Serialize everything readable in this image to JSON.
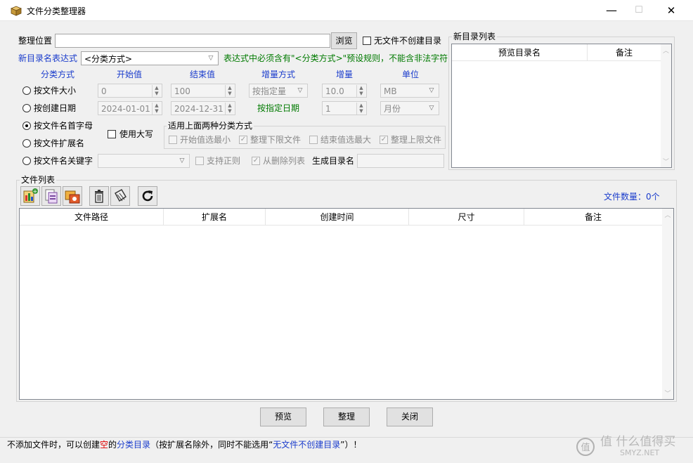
{
  "window": {
    "title": "文件分类整理器",
    "min": "—",
    "max": "☐",
    "close": "✕"
  },
  "location": {
    "label": "整理位置",
    "value": "",
    "browse": "浏览",
    "no_create_label": "无文件不创建目录"
  },
  "expr": {
    "label": "新目录名表达式",
    "value": "<分类方式>",
    "hint": "表达式中必须含有\"<分类方式>\"预设规则，不能含非法字符"
  },
  "headers": {
    "mode": "分类方式",
    "start": "开始值",
    "end": "结束值",
    "inc_mode": "增量方式",
    "inc": "增量",
    "unit": "单位"
  },
  "rows": {
    "size": {
      "label": "按文件大小",
      "start": "0",
      "end": "100",
      "inc_mode": "按指定量",
      "inc": "10.0",
      "unit": "MB"
    },
    "date": {
      "label": "按创建日期",
      "start": "2024-01-01",
      "end": "2024-12-31",
      "inc_mode": "按指定日期",
      "inc": "1",
      "unit": "月份"
    },
    "initial": {
      "label": "按文件名首字母",
      "uppercase": "使用大写"
    },
    "ext": {
      "label": "按文件扩展名"
    },
    "keyword": {
      "label": "按文件名关键字",
      "value": "",
      "regex": "支持正则",
      "remove_from_list": "从删除列表",
      "gen_dir_label": "生成目录名",
      "gen_dir_value": ""
    }
  },
  "applies": {
    "title": "适用上面两种分类方式",
    "start_min": "开始值选最小",
    "lower_file": "整理下限文件",
    "end_max": "结束值选最大",
    "upper_file": "整理上限文件"
  },
  "new_dirs": {
    "title": "新目录列表",
    "col_preview": "预览目录名",
    "col_note": "备注"
  },
  "files": {
    "title": "文件列表",
    "count_label": "文件数量：0个",
    "cols": [
      "文件路径",
      "扩展名",
      "创建时间",
      "尺寸",
      "备注"
    ]
  },
  "toolbar": {
    "icons": [
      "add-files-icon",
      "add-folder-icon",
      "import-icon",
      "delete-icon",
      "clear-icon",
      "refresh-icon"
    ]
  },
  "buttons": {
    "preview": "预览",
    "organize": "整理",
    "close": "关闭"
  },
  "status": {
    "p1": "不添加文件时，可以创建",
    "p2": "空",
    "p3": "的",
    "p4": "分类目录",
    "p5": "（按扩展名除外，同时不能选用“",
    "p6": "无文件不创建目录",
    "p7": "”）！"
  },
  "colors": {
    "blue": "#1a3ccc",
    "green": "#007a00",
    "red": "#e00000"
  },
  "watermark": {
    "text": "值 什么值得买",
    "sub": "SMYZ.NET"
  }
}
